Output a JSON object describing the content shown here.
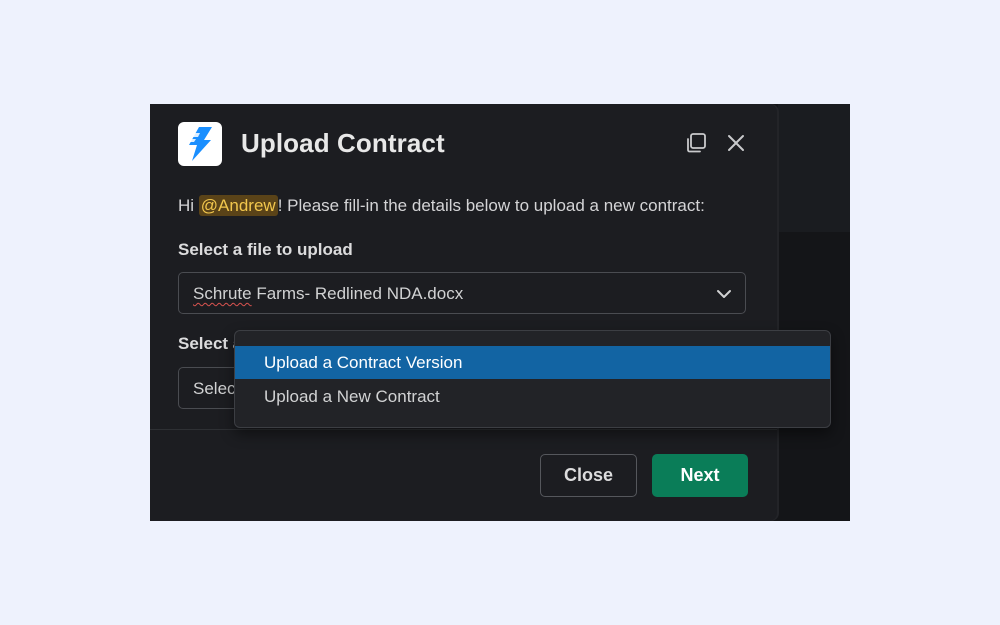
{
  "modal": {
    "title": "Upload Contract",
    "intro_prefix": "Hi ",
    "mention": "@Andrew",
    "intro_suffix": "! Please fill-in the details below to upload a new contract:"
  },
  "file_field": {
    "label": "Select a file to upload",
    "value_part1": "Schrute",
    "value_part2": " Farms- Redlined NDA.docx"
  },
  "action_field": {
    "label_visible": "Select a",
    "placeholder_visible": "Selec"
  },
  "dropdown": {
    "options": [
      "Upload a Contract Version",
      "Upload a New Contract"
    ],
    "highlighted_index": 0
  },
  "footer": {
    "close_label": "Close",
    "next_label": "Next"
  },
  "colors": {
    "accent_primary": "#0a7d58",
    "highlight": "#1264a3",
    "mention_text": "#f2c74d",
    "modal_bg": "#1c1d21",
    "page_bg": "#eef2fd"
  },
  "icons": {
    "app": "lightning-bolt-icon",
    "popout": "popout-window-icon",
    "close": "close-icon",
    "chevron": "chevron-down-icon"
  }
}
